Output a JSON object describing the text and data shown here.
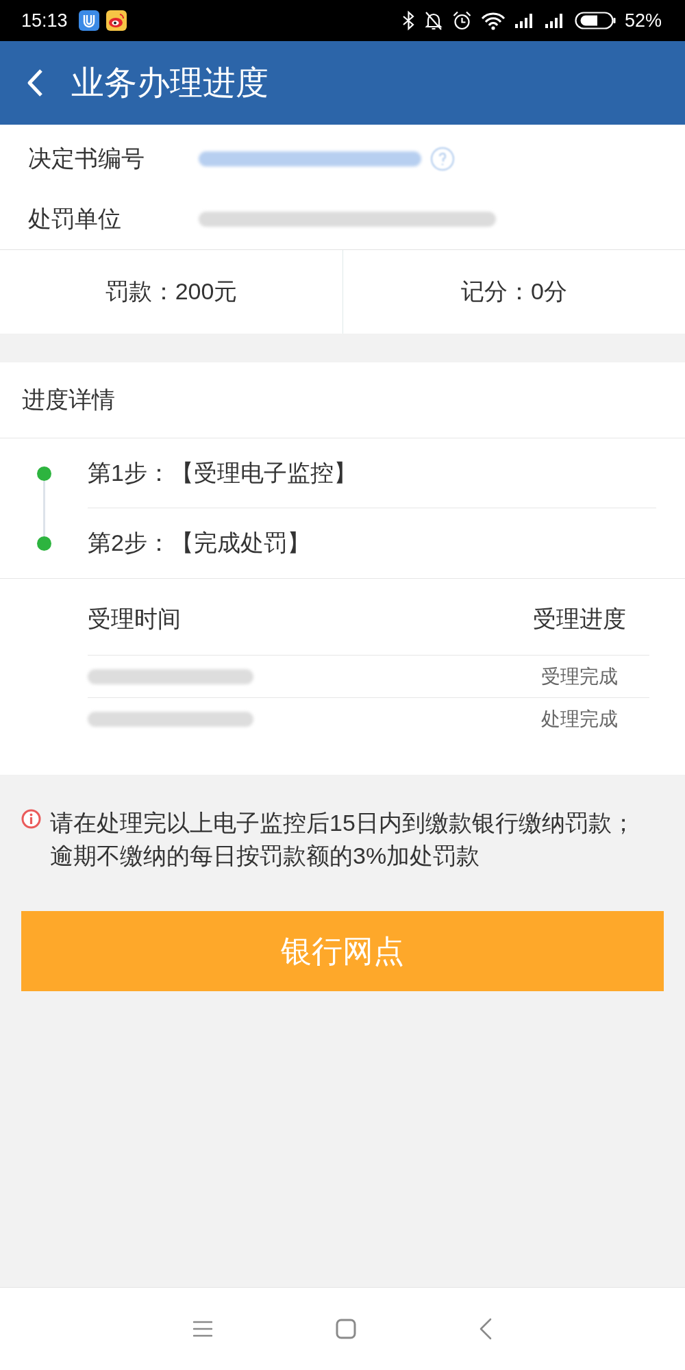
{
  "status_bar": {
    "time": "15:13",
    "battery": "52%"
  },
  "header": {
    "title": "业务办理进度"
  },
  "info_rows": [
    {
      "label": "决定书编号",
      "kind": "redacted_link"
    },
    {
      "label": "处罚单位",
      "kind": "redacted_text"
    }
  ],
  "summary": [
    {
      "text": "罚款：200元"
    },
    {
      "text": "记分：0分"
    }
  ],
  "progress": {
    "title": "进度详情",
    "steps": [
      {
        "text": "第1步：【受理电子监控】",
        "done": true
      },
      {
        "text": "第2步：【完成处罚】",
        "done": true
      }
    ]
  },
  "records": {
    "columns": [
      "受理时间",
      "受理进度"
    ],
    "rows": [
      {
        "kind": "redacted_time",
        "status": "受理完成"
      },
      {
        "kind": "redacted_time",
        "status": "处理完成"
      }
    ]
  },
  "notice": {
    "text": "请在处理完以上电子监控后15日内到缴款银行缴纳罚款；逾期不缴纳的每日按罚款额的3%加处罚款"
  },
  "action_button": {
    "label": "银行网点"
  }
}
